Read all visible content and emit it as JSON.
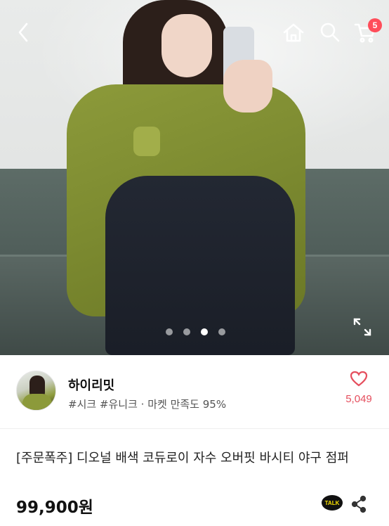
{
  "header": {
    "back_icon": "back-arrow-icon",
    "home_icon": "home-icon",
    "search_icon": "search-icon",
    "cart_icon": "cart-icon",
    "cart_count": "5"
  },
  "gallery": {
    "image_count": 4,
    "active_index": 2,
    "expand_icon": "expand-icon"
  },
  "shop": {
    "name": "하이리밋",
    "meta": "#시크 #유니크 · 마켓 만족도 95%",
    "like_count": "5,049"
  },
  "product": {
    "title": "[주문폭주] 디오널 배색 코듀로이 자수 오버핏 바시티 야구 점퍼",
    "price": "99,900원",
    "talk_label": "TALK"
  },
  "colors": {
    "accent": "#e54e5d",
    "badge": "#ff4d5a",
    "talk_yellow": "#f9e000"
  }
}
